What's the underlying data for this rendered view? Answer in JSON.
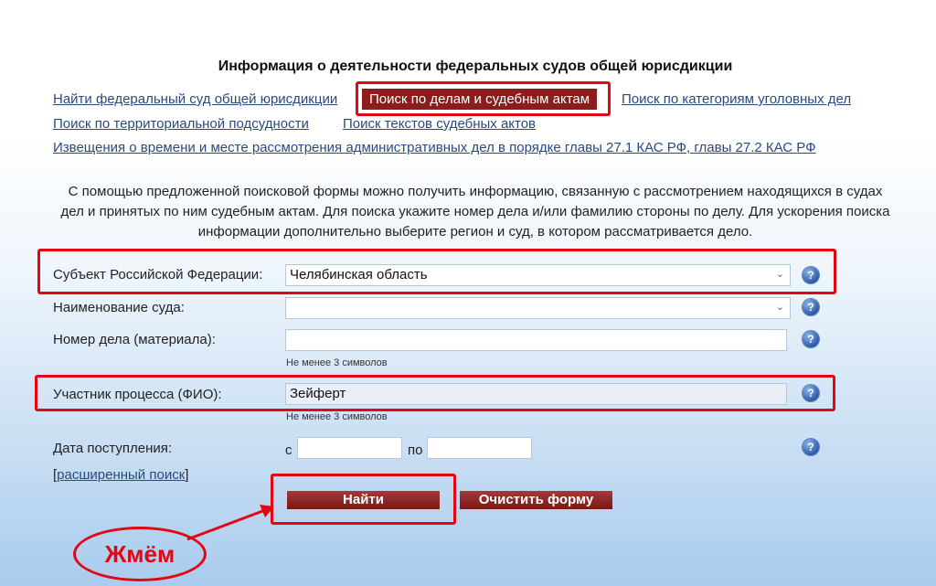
{
  "header": {
    "title": "Информация о деятельности федеральных судов общей юрисдикции"
  },
  "nav": {
    "find_court": "Найти федеральный суд общей юрисдикции",
    "search_cases_active": "Поиск по делам и судебным актам",
    "search_criminal_categories": "Поиск по категориям уголовных дел",
    "territorial": "Поиск по территориальной подсудности",
    "texts": "Поиск текстов судебных актов",
    "notices": "Извещения о времени и месте рассмотрения административных дел в порядке главы 27.1 КАС РФ, главы 27.2 КАС РФ"
  },
  "intro": {
    "text": "С помощью предложенной поисковой формы можно получить информацию, связанную с рассмотрением находящихся в судах дел и принятых по ним судебным актам. Для поиска укажите номер дела и/или фамилию стороны по делу. Для ускорения поиска информации дополнительно выберите регион и суд, в котором рассматривается дело."
  },
  "form": {
    "subject": {
      "label": "Субъект Российской Федерации:",
      "value": "Челябинская область"
    },
    "court": {
      "label": "Наименование суда:",
      "value": ""
    },
    "case_number": {
      "label": "Номер дела (материала):",
      "value": "",
      "hint": "Не менее 3 символов"
    },
    "participant": {
      "label": "Участник процесса (ФИО):",
      "value": "Зейферт",
      "hint": "Не менее 3 символов"
    },
    "date": {
      "label": "Дата поступления:",
      "from_label": "с",
      "to_label": "по",
      "from_value": "",
      "to_value": ""
    },
    "advanced": {
      "open": "[",
      "link": "расширенный поиск",
      "close": "]"
    },
    "help_symbol": "?"
  },
  "buttons": {
    "find": "Найти",
    "clear": "Очистить форму"
  },
  "annotation": {
    "text": "Жмём",
    "color": "#e30613"
  },
  "colors": {
    "accent": "#8b1d1d",
    "link": "#2a4a7f"
  }
}
